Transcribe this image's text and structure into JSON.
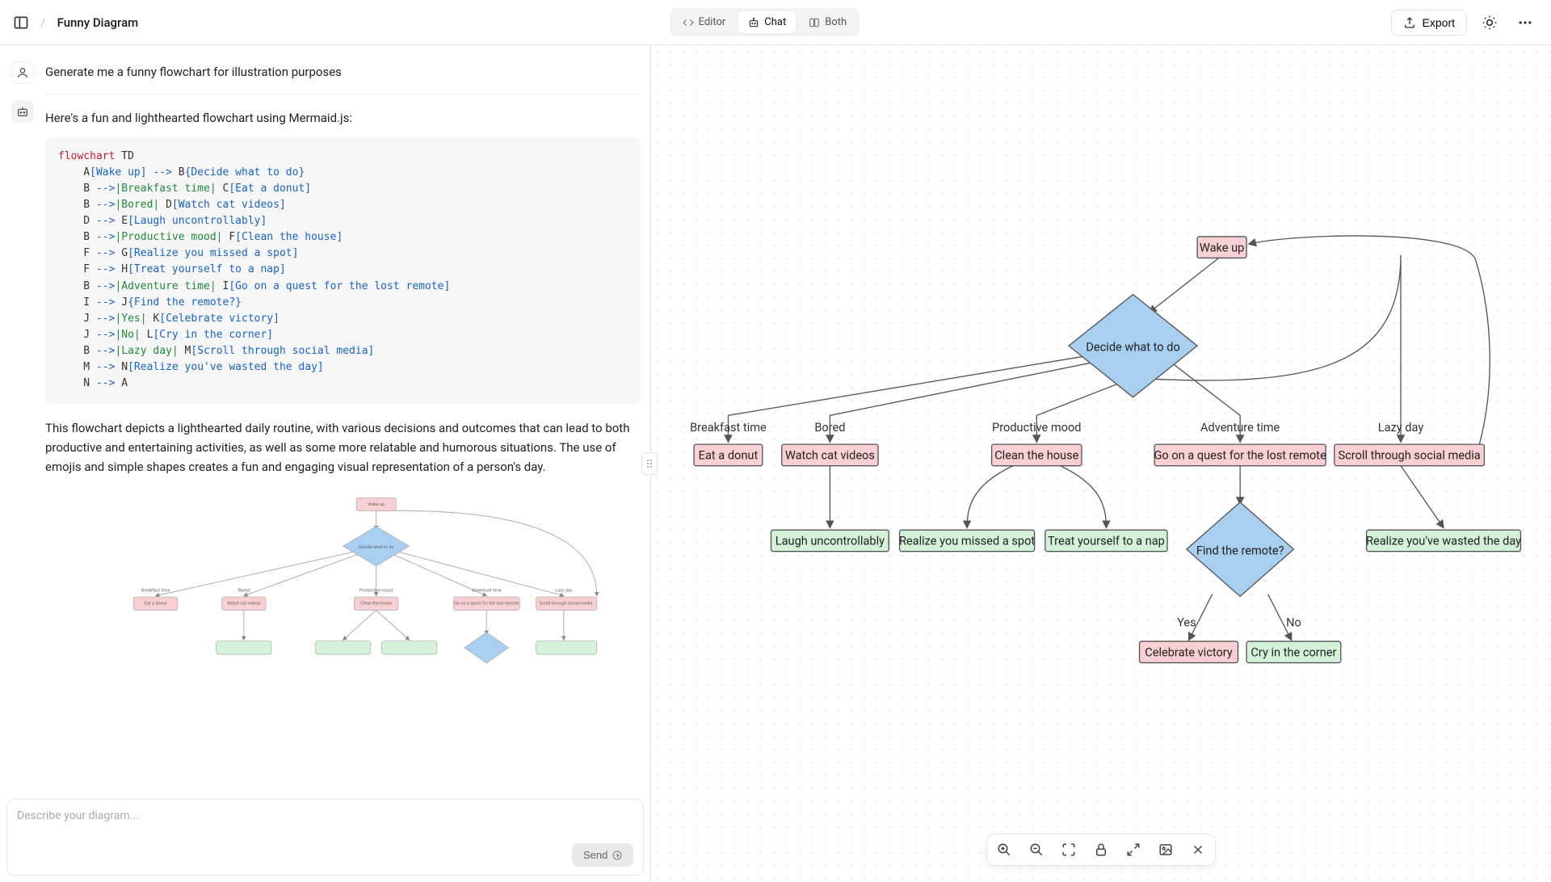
{
  "header": {
    "title": "Funny Diagram",
    "tabs": {
      "editor": "Editor",
      "chat": "Chat",
      "both": "Both"
    },
    "export_label": "Export"
  },
  "chat": {
    "user_prompt": "Generate me a funny flowchart for illustration purposes",
    "bot_intro": "Here's a fun and lighthearted flowchart using Mermaid.js:",
    "bot_explain": "This flowchart depicts a lighthearted daily routine, with various decisions and outcomes that can lead to both productive and entertaining activities, as well as some more relatable and humorous situations. The use of emojis and simple shapes creates a fun and engaging visual representation of a person's day."
  },
  "code": {
    "kw": "flowchart",
    "td": " TD",
    "lines": [
      {
        "pre": "    A",
        "br1": "[Wake up]",
        "arr": " --> ",
        "mid": "B",
        "br2": "{Decide what to do}"
      },
      {
        "pre": "    B ",
        "arr": "-->",
        "lbl": "|Breakfast time|",
        "mid": " C",
        "br2": "[Eat a donut]"
      },
      {
        "pre": "    B ",
        "arr": "-->",
        "lbl": "|Bored|",
        "mid": " D",
        "br2": "[Watch cat videos]"
      },
      {
        "pre": "    D ",
        "arr": "-->",
        "mid": " E",
        "br2": "[Laugh uncontrollably]"
      },
      {
        "pre": "    B ",
        "arr": "-->",
        "lbl": "|Productive mood|",
        "mid": " F",
        "br2": "[Clean the house]"
      },
      {
        "pre": "    F ",
        "arr": "-->",
        "mid": " G",
        "br2": "[Realize you missed a spot]"
      },
      {
        "pre": "    F ",
        "arr": "-->",
        "mid": " H",
        "br2": "[Treat yourself to a nap]"
      },
      {
        "pre": "    B ",
        "arr": "-->",
        "lbl": "|Adventure time|",
        "mid": " I",
        "br2": "[Go on a quest for the lost remote]"
      },
      {
        "pre": "    I ",
        "arr": "-->",
        "mid": " J",
        "br2": "{Find the remote?}"
      },
      {
        "pre": "    J ",
        "arr": "-->",
        "lbl": "|Yes|",
        "mid": " K",
        "br2": "[Celebrate victory]"
      },
      {
        "pre": "    J ",
        "arr": "-->",
        "lbl": "|No|",
        "mid": " L",
        "br2": "[Cry in the corner]"
      },
      {
        "pre": "    B ",
        "arr": "-->",
        "lbl": "|Lazy day|",
        "mid": " M",
        "br2": "[Scroll through social media]"
      },
      {
        "pre": "    M ",
        "arr": "-->",
        "mid": " N",
        "br2": "[Realize you've wasted the day]"
      },
      {
        "pre": "    N ",
        "arr": "-->",
        "mid": " A"
      }
    ]
  },
  "composer": {
    "placeholder": "Describe your diagram...",
    "send_label": "Send"
  },
  "diagram": {
    "nodes": {
      "A": "Wake up",
      "B": "Decide what to do",
      "C": "Eat a donut",
      "D": "Watch cat videos",
      "E": "Laugh uncontrollably",
      "F": "Clean the house",
      "G": "Realize you missed a spot",
      "H": "Treat yourself to a nap",
      "I": "Go on a quest for the lost remote",
      "J": "Find the remote?",
      "K": "Celebrate victory",
      "L": "Cry in the corner",
      "M": "Scroll through social media",
      "N": "Realize you've wasted the day"
    },
    "edge_labels": {
      "breakfast": "Breakfast time",
      "bored": "Bored",
      "productive": "Productive mood",
      "adventure": "Adventure time",
      "lazy": "Lazy day",
      "yes": "Yes",
      "no": "No"
    }
  },
  "chart_data": {
    "type": "flowchart",
    "direction": "TD",
    "nodes": [
      {
        "id": "A",
        "label": "Wake up",
        "shape": "rect"
      },
      {
        "id": "B",
        "label": "Decide what to do",
        "shape": "diamond"
      },
      {
        "id": "C",
        "label": "Eat a donut",
        "shape": "rect"
      },
      {
        "id": "D",
        "label": "Watch cat videos",
        "shape": "rect"
      },
      {
        "id": "E",
        "label": "Laugh uncontrollably",
        "shape": "rect"
      },
      {
        "id": "F",
        "label": "Clean the house",
        "shape": "rect"
      },
      {
        "id": "G",
        "label": "Realize you missed a spot",
        "shape": "rect"
      },
      {
        "id": "H",
        "label": "Treat yourself to a nap",
        "shape": "rect"
      },
      {
        "id": "I",
        "label": "Go on a quest for the lost remote",
        "shape": "rect"
      },
      {
        "id": "J",
        "label": "Find the remote?",
        "shape": "diamond"
      },
      {
        "id": "K",
        "label": "Celebrate victory",
        "shape": "rect"
      },
      {
        "id": "L",
        "label": "Cry in the corner",
        "shape": "rect"
      },
      {
        "id": "M",
        "label": "Scroll through social media",
        "shape": "rect"
      },
      {
        "id": "N",
        "label": "Realize you've wasted the day",
        "shape": "rect"
      }
    ],
    "edges": [
      {
        "from": "A",
        "to": "B"
      },
      {
        "from": "B",
        "to": "C",
        "label": "Breakfast time"
      },
      {
        "from": "B",
        "to": "D",
        "label": "Bored"
      },
      {
        "from": "D",
        "to": "E"
      },
      {
        "from": "B",
        "to": "F",
        "label": "Productive mood"
      },
      {
        "from": "F",
        "to": "G"
      },
      {
        "from": "F",
        "to": "H"
      },
      {
        "from": "B",
        "to": "I",
        "label": "Adventure time"
      },
      {
        "from": "I",
        "to": "J"
      },
      {
        "from": "J",
        "to": "K",
        "label": "Yes"
      },
      {
        "from": "J",
        "to": "L",
        "label": "No"
      },
      {
        "from": "B",
        "to": "M",
        "label": "Lazy day"
      },
      {
        "from": "M",
        "to": "N"
      },
      {
        "from": "N",
        "to": "A"
      }
    ]
  }
}
